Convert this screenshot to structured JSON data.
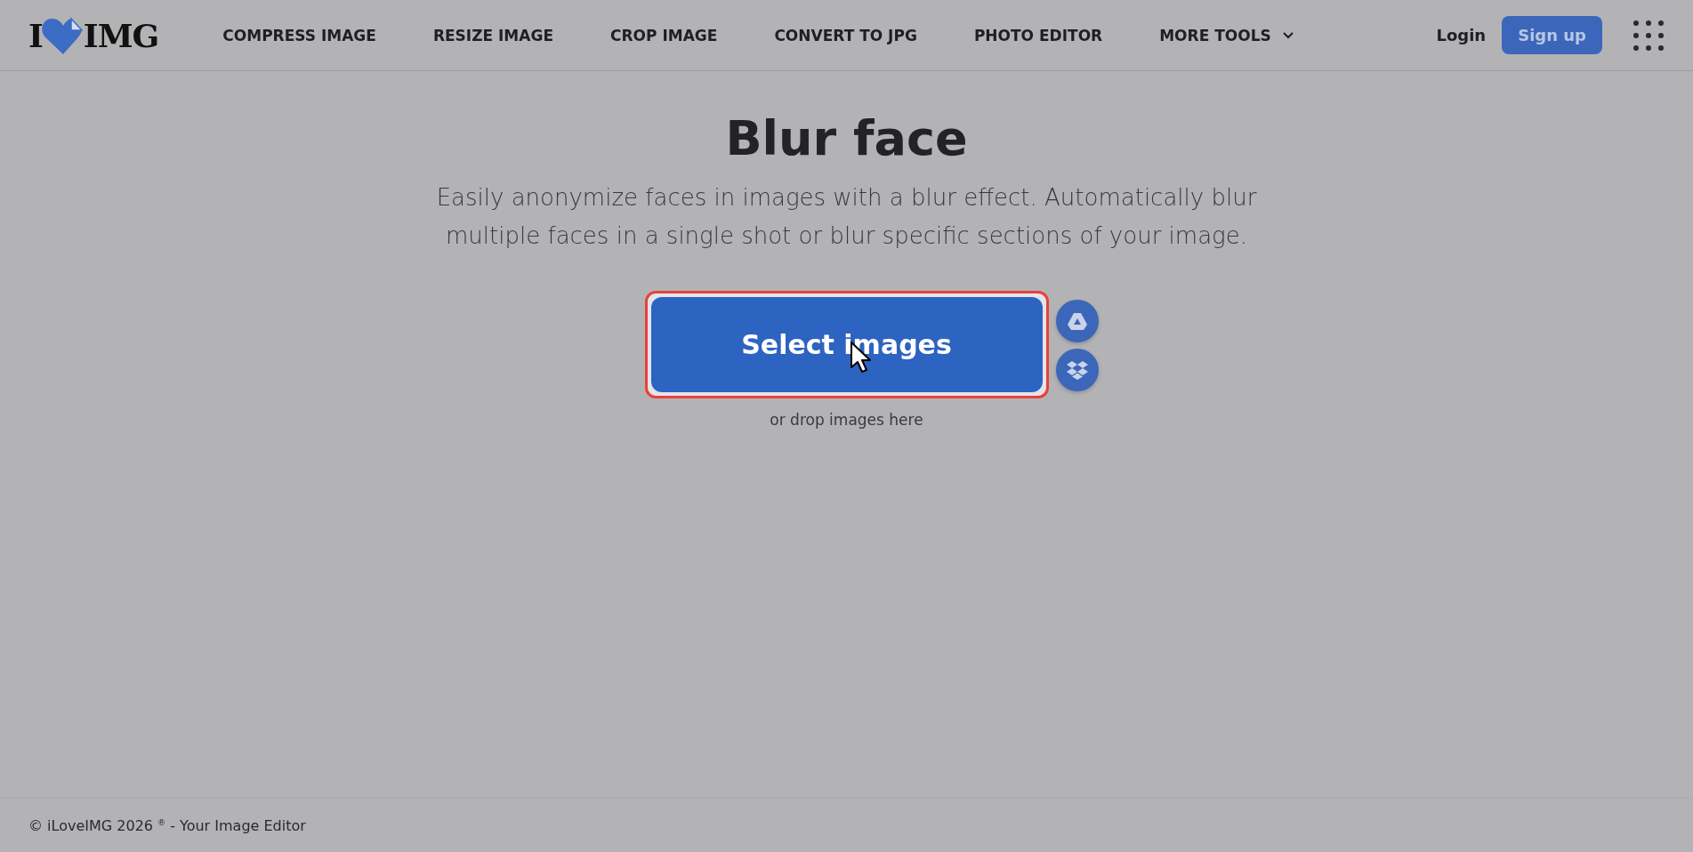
{
  "header": {
    "logo": {
      "left": "I",
      "right": "IMG"
    },
    "nav": [
      {
        "label": "COMPRESS IMAGE",
        "kind": "link"
      },
      {
        "label": "RESIZE IMAGE",
        "kind": "link"
      },
      {
        "label": "CROP IMAGE",
        "kind": "link"
      },
      {
        "label": "CONVERT TO JPG",
        "kind": "link"
      },
      {
        "label": "PHOTO EDITOR",
        "kind": "link"
      },
      {
        "label": "MORE TOOLS",
        "kind": "dropdown"
      }
    ],
    "login": "Login",
    "signup": "Sign up"
  },
  "main": {
    "title": "Blur face",
    "subtitle": "Easily anonymize faces in images with a blur effect. Automatically blur multiple faces in a single shot or blur specific sections of your image.",
    "select_button": "Select images",
    "drop_hint": "or drop images here"
  },
  "footer": {
    "text": "© iLoveIMG 2026 $^{®}$ - Your Image Editor"
  }
}
